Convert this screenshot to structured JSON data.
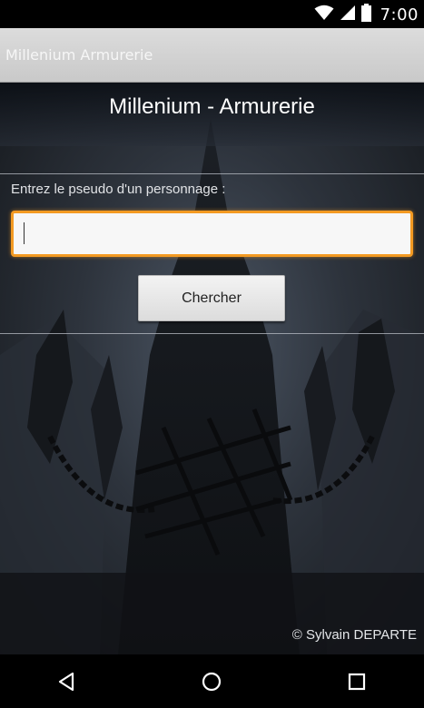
{
  "status_bar": {
    "time": "7:00",
    "icons": [
      "wifi-icon",
      "cell-signal-icon",
      "battery-icon"
    ]
  },
  "action_bar": {
    "title": "Millenium Armurerie"
  },
  "main": {
    "title": "Millenium - Armurerie",
    "prompt_label": "Entrez le pseudo d'un personnage :",
    "pseudo_input": {
      "value": "",
      "placeholder": ""
    },
    "search_button_label": "Chercher",
    "copyright": "© Sylvain DEPARTE"
  },
  "nav_bar": {
    "icons": [
      "back-icon",
      "home-icon",
      "recents-icon"
    ]
  },
  "colors": {
    "input_focus_border": "#f39a22",
    "action_bar_bg": "#d3d3d3"
  }
}
